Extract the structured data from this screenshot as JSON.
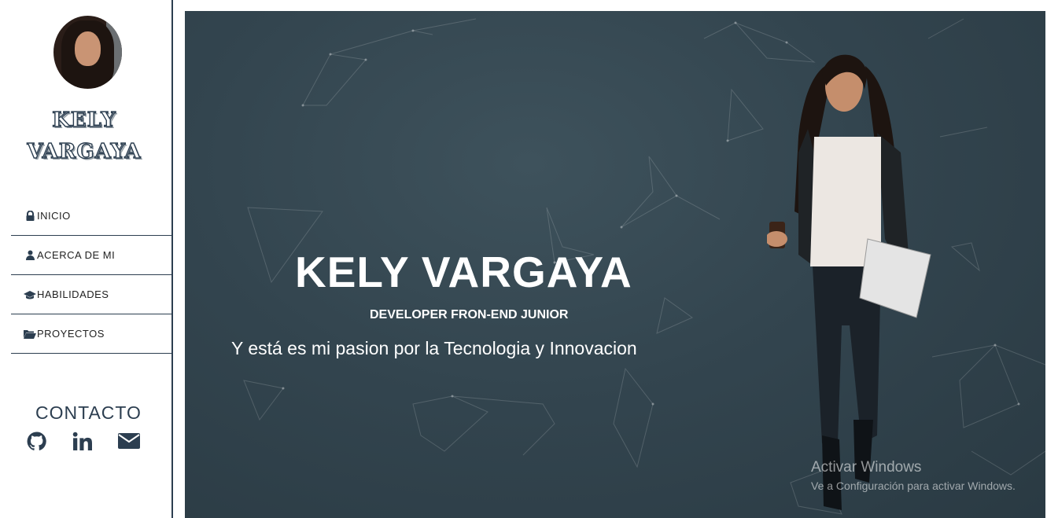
{
  "sidebar": {
    "brand_line1": "KELY",
    "brand_line2": "VARGAYA",
    "nav": [
      {
        "label": "INICIO",
        "icon": "lock-icon"
      },
      {
        "label": "ACERCA DE MI",
        "icon": "user-icon"
      },
      {
        "label": "HABILIDADES",
        "icon": "graduation-cap-icon"
      },
      {
        "label": "PROYECTOS",
        "icon": "folder-open-icon"
      }
    ],
    "contact_title": "CONTACTO",
    "social": [
      {
        "icon": "github-icon"
      },
      {
        "icon": "linkedin-icon"
      },
      {
        "icon": "envelope-icon"
      }
    ]
  },
  "hero": {
    "name": "KELY VARGAYA",
    "role": "DEVELOPER FRON-END JUNIOR",
    "tagline": "Y está es mi pasion por la Tecnologia y Innovacion"
  },
  "watermark": {
    "title": "Activar Windows",
    "subtitle": "Ve a Configuración para activar Windows."
  },
  "colors": {
    "accent": "#2c3e50",
    "hero_bg": "#33454f",
    "text_light": "#ffffff"
  }
}
